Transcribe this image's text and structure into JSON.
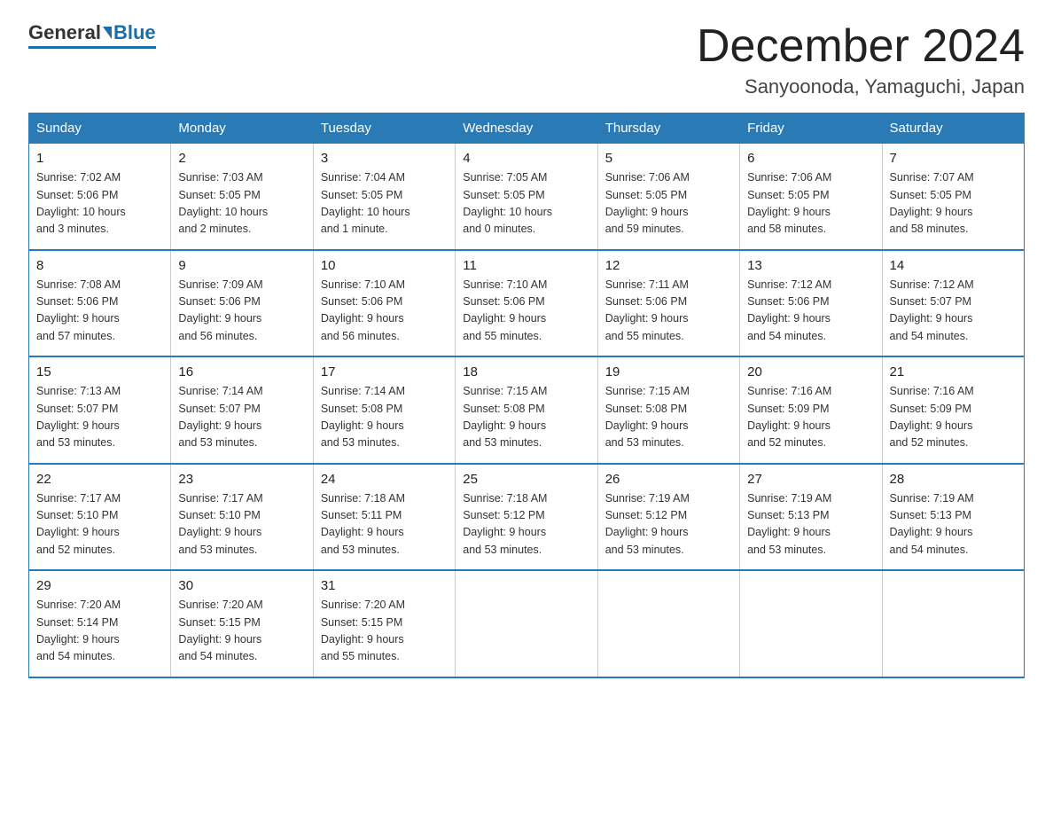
{
  "logo": {
    "general": "General",
    "blue": "Blue"
  },
  "header": {
    "title": "December 2024",
    "subtitle": "Sanyoonoda, Yamaguchi, Japan"
  },
  "weekdays": [
    "Sunday",
    "Monday",
    "Tuesday",
    "Wednesday",
    "Thursday",
    "Friday",
    "Saturday"
  ],
  "weeks": [
    [
      {
        "day": "1",
        "info": "Sunrise: 7:02 AM\nSunset: 5:06 PM\nDaylight: 10 hours\nand 3 minutes."
      },
      {
        "day": "2",
        "info": "Sunrise: 7:03 AM\nSunset: 5:05 PM\nDaylight: 10 hours\nand 2 minutes."
      },
      {
        "day": "3",
        "info": "Sunrise: 7:04 AM\nSunset: 5:05 PM\nDaylight: 10 hours\nand 1 minute."
      },
      {
        "day": "4",
        "info": "Sunrise: 7:05 AM\nSunset: 5:05 PM\nDaylight: 10 hours\nand 0 minutes."
      },
      {
        "day": "5",
        "info": "Sunrise: 7:06 AM\nSunset: 5:05 PM\nDaylight: 9 hours\nand 59 minutes."
      },
      {
        "day": "6",
        "info": "Sunrise: 7:06 AM\nSunset: 5:05 PM\nDaylight: 9 hours\nand 58 minutes."
      },
      {
        "day": "7",
        "info": "Sunrise: 7:07 AM\nSunset: 5:05 PM\nDaylight: 9 hours\nand 58 minutes."
      }
    ],
    [
      {
        "day": "8",
        "info": "Sunrise: 7:08 AM\nSunset: 5:06 PM\nDaylight: 9 hours\nand 57 minutes."
      },
      {
        "day": "9",
        "info": "Sunrise: 7:09 AM\nSunset: 5:06 PM\nDaylight: 9 hours\nand 56 minutes."
      },
      {
        "day": "10",
        "info": "Sunrise: 7:10 AM\nSunset: 5:06 PM\nDaylight: 9 hours\nand 56 minutes."
      },
      {
        "day": "11",
        "info": "Sunrise: 7:10 AM\nSunset: 5:06 PM\nDaylight: 9 hours\nand 55 minutes."
      },
      {
        "day": "12",
        "info": "Sunrise: 7:11 AM\nSunset: 5:06 PM\nDaylight: 9 hours\nand 55 minutes."
      },
      {
        "day": "13",
        "info": "Sunrise: 7:12 AM\nSunset: 5:06 PM\nDaylight: 9 hours\nand 54 minutes."
      },
      {
        "day": "14",
        "info": "Sunrise: 7:12 AM\nSunset: 5:07 PM\nDaylight: 9 hours\nand 54 minutes."
      }
    ],
    [
      {
        "day": "15",
        "info": "Sunrise: 7:13 AM\nSunset: 5:07 PM\nDaylight: 9 hours\nand 53 minutes."
      },
      {
        "day": "16",
        "info": "Sunrise: 7:14 AM\nSunset: 5:07 PM\nDaylight: 9 hours\nand 53 minutes."
      },
      {
        "day": "17",
        "info": "Sunrise: 7:14 AM\nSunset: 5:08 PM\nDaylight: 9 hours\nand 53 minutes."
      },
      {
        "day": "18",
        "info": "Sunrise: 7:15 AM\nSunset: 5:08 PM\nDaylight: 9 hours\nand 53 minutes."
      },
      {
        "day": "19",
        "info": "Sunrise: 7:15 AM\nSunset: 5:08 PM\nDaylight: 9 hours\nand 53 minutes."
      },
      {
        "day": "20",
        "info": "Sunrise: 7:16 AM\nSunset: 5:09 PM\nDaylight: 9 hours\nand 52 minutes."
      },
      {
        "day": "21",
        "info": "Sunrise: 7:16 AM\nSunset: 5:09 PM\nDaylight: 9 hours\nand 52 minutes."
      }
    ],
    [
      {
        "day": "22",
        "info": "Sunrise: 7:17 AM\nSunset: 5:10 PM\nDaylight: 9 hours\nand 52 minutes."
      },
      {
        "day": "23",
        "info": "Sunrise: 7:17 AM\nSunset: 5:10 PM\nDaylight: 9 hours\nand 53 minutes."
      },
      {
        "day": "24",
        "info": "Sunrise: 7:18 AM\nSunset: 5:11 PM\nDaylight: 9 hours\nand 53 minutes."
      },
      {
        "day": "25",
        "info": "Sunrise: 7:18 AM\nSunset: 5:12 PM\nDaylight: 9 hours\nand 53 minutes."
      },
      {
        "day": "26",
        "info": "Sunrise: 7:19 AM\nSunset: 5:12 PM\nDaylight: 9 hours\nand 53 minutes."
      },
      {
        "day": "27",
        "info": "Sunrise: 7:19 AM\nSunset: 5:13 PM\nDaylight: 9 hours\nand 53 minutes."
      },
      {
        "day": "28",
        "info": "Sunrise: 7:19 AM\nSunset: 5:13 PM\nDaylight: 9 hours\nand 54 minutes."
      }
    ],
    [
      {
        "day": "29",
        "info": "Sunrise: 7:20 AM\nSunset: 5:14 PM\nDaylight: 9 hours\nand 54 minutes."
      },
      {
        "day": "30",
        "info": "Sunrise: 7:20 AM\nSunset: 5:15 PM\nDaylight: 9 hours\nand 54 minutes."
      },
      {
        "day": "31",
        "info": "Sunrise: 7:20 AM\nSunset: 5:15 PM\nDaylight: 9 hours\nand 55 minutes."
      },
      {
        "day": "",
        "info": ""
      },
      {
        "day": "",
        "info": ""
      },
      {
        "day": "",
        "info": ""
      },
      {
        "day": "",
        "info": ""
      }
    ]
  ]
}
